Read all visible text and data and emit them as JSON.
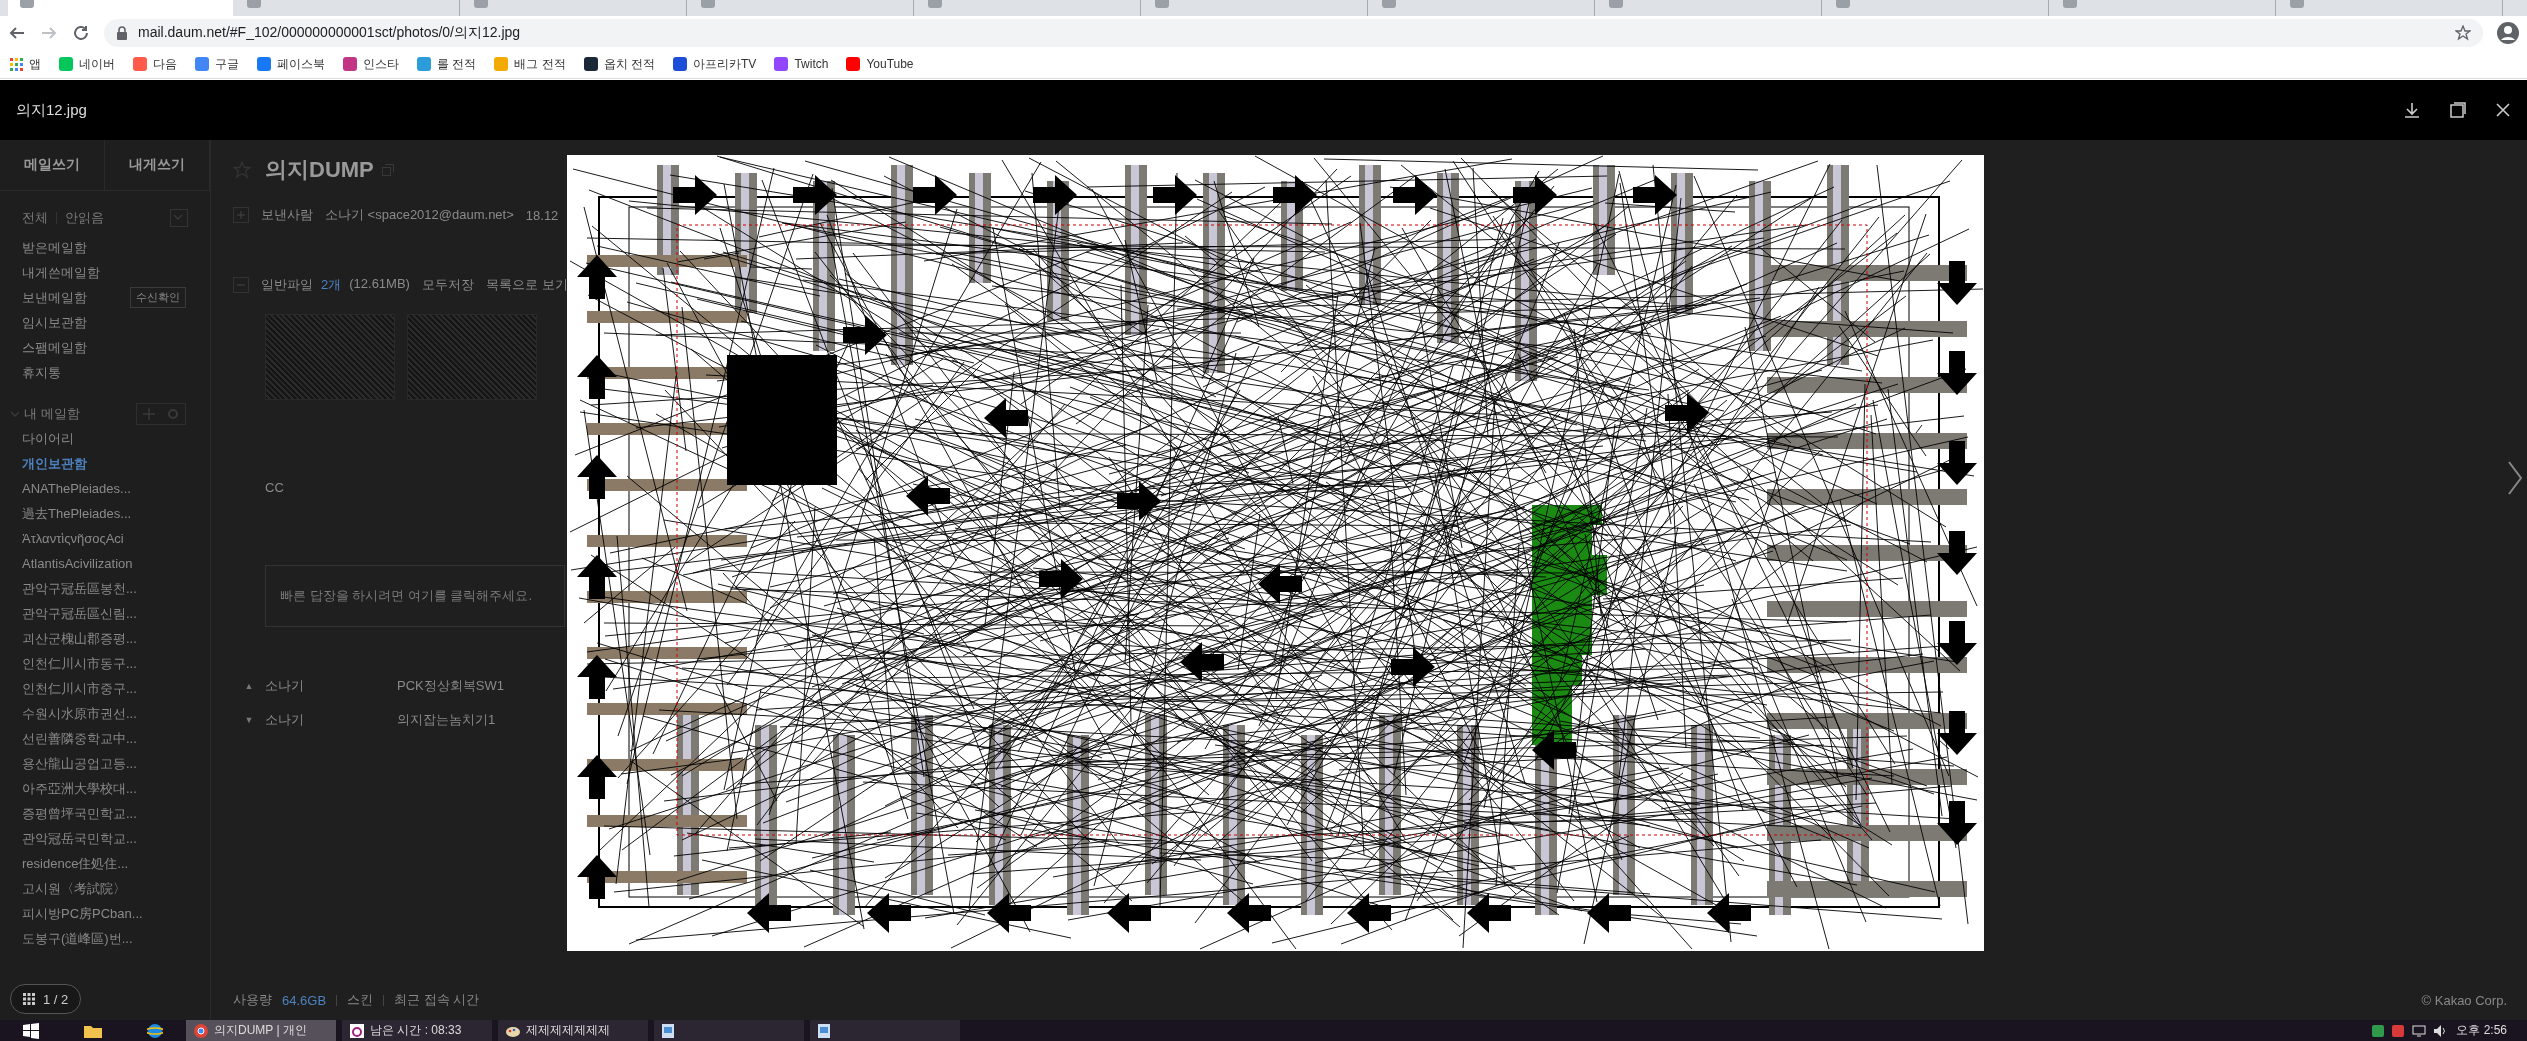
{
  "browser": {
    "tabs": [
      {
        "selected": true
      },
      {
        "selected": false
      },
      {
        "selected": false
      },
      {
        "selected": false
      },
      {
        "selected": false
      },
      {
        "selected": false
      },
      {
        "selected": false
      },
      {
        "selected": false
      },
      {
        "selected": false
      },
      {
        "selected": false
      },
      {
        "selected": false
      }
    ],
    "address": "mail.daum.net/#F_102/000000000001sct/photos/0/의지12.jpg",
    "bookmarks": [
      {
        "kind": "apps",
        "label": "앱"
      },
      {
        "kind": "site",
        "label": "네이버",
        "color": "#03c75a"
      },
      {
        "kind": "site",
        "label": "다음",
        "color": "#ff5a4a"
      },
      {
        "kind": "site",
        "label": "구글",
        "color": "#4285f4"
      },
      {
        "kind": "site",
        "label": "페이스북",
        "color": "#1877f2"
      },
      {
        "kind": "site",
        "label": "인스타",
        "color": "#c13584"
      },
      {
        "kind": "site",
        "label": "롤 전적",
        "color": "#2d9cdb"
      },
      {
        "kind": "site",
        "label": "배그 전적",
        "color": "#f2a900"
      },
      {
        "kind": "site",
        "label": "옵치 전적",
        "color": "#1b2838"
      },
      {
        "kind": "site",
        "label": "아프리카TV",
        "color": "#1d4ed8"
      },
      {
        "kind": "site",
        "label": "Twitch",
        "color": "#9146ff"
      },
      {
        "kind": "site",
        "label": "YouTube",
        "color": "#ff0000"
      }
    ]
  },
  "viewer": {
    "title": "의지12.jpg",
    "page": "1 / 2"
  },
  "sidebar": {
    "buttons": [
      "메일쓰기",
      "내게쓰기"
    ],
    "filters": [
      "전체",
      "안읽음"
    ],
    "folders": [
      {
        "label": "받은메일함"
      },
      {
        "label": "내게쓴메일함"
      },
      {
        "label": "보낸메일함",
        "action": "수신확인"
      },
      {
        "label": "임시보관함"
      },
      {
        "label": "스팸메일함"
      },
      {
        "label": "휴지통"
      }
    ],
    "my_folders_title": "내 메일함",
    "my_folders": [
      {
        "label": "다이어리",
        "selected": false
      },
      {
        "label": "개인보관함",
        "selected": true
      },
      {
        "label": "ANAThePleiades...",
        "selected": false
      },
      {
        "label": "過去ThePleiades...",
        "selected": false
      },
      {
        "label": "ἈτλαντὶςνῆσοςAci",
        "selected": false
      },
      {
        "label": "AtlantisAcivilization",
        "selected": false
      },
      {
        "label": "관악구冠岳區봉천...",
        "selected": false
      },
      {
        "label": "관악구冠岳區신림...",
        "selected": false
      },
      {
        "label": "괴산군槐山郡증평...",
        "selected": false
      },
      {
        "label": "인천仁川시市동구...",
        "selected": false
      },
      {
        "label": "인천仁川시市중구...",
        "selected": false
      },
      {
        "label": "수원시水原市권선...",
        "selected": false
      },
      {
        "label": "선린善隣중학교中...",
        "selected": false
      },
      {
        "label": "용산龍山공업고등...",
        "selected": false
      },
      {
        "label": "아주亞洲大學校대...",
        "selected": false
      },
      {
        "label": "증평曾坪국민학교...",
        "selected": false
      },
      {
        "label": "관악冠岳국민학교...",
        "selected": false
      },
      {
        "label": "residence住処住...",
        "selected": false
      },
      {
        "label": "고시원〈考試院〉",
        "selected": false
      },
      {
        "label": "피시방PC房PCban...",
        "selected": false
      },
      {
        "label": "도봉구(道峰區)번...",
        "selected": false
      }
    ]
  },
  "mail": {
    "subject": "의지DUMP",
    "sender_label": "보낸사람",
    "sender": "소나기 <space2012@daum.net>",
    "date": "18.12",
    "attachments": {
      "label": "일반파일",
      "count": "2개",
      "size": "(12.61MB)",
      "actions": [
        "모두저장",
        "목록으로 보기"
      ]
    },
    "cc": "CC",
    "reply_placeholder": "빠른 답장을 하시려면 여기를 클릭해주세요.",
    "nearby": [
      {
        "arrow": "▲",
        "sender": "소나기",
        "subject": "PCK정상회복SW1"
      },
      {
        "arrow": "▼",
        "sender": "소나기",
        "subject": "의지잡는놈치기1"
      }
    ]
  },
  "footer": {
    "usage_label": "사용량",
    "usage": "64.6GB",
    "links": [
      "스킨",
      "최근 접속 시간"
    ],
    "copyright": "© Kakao Corp."
  },
  "taskbar": {
    "apps": [
      {
        "kind": "browser",
        "label": "의지DUMP | 개인",
        "active": true
      },
      {
        "kind": "timer",
        "label": "남은 시간 : 08:33",
        "active": false
      },
      {
        "kind": "paint",
        "label": "제제제제제제제",
        "active": false
      },
      {
        "kind": "image",
        "active": false
      },
      {
        "kind": "image",
        "active": false
      }
    ],
    "clock": "오후 2:56"
  }
}
